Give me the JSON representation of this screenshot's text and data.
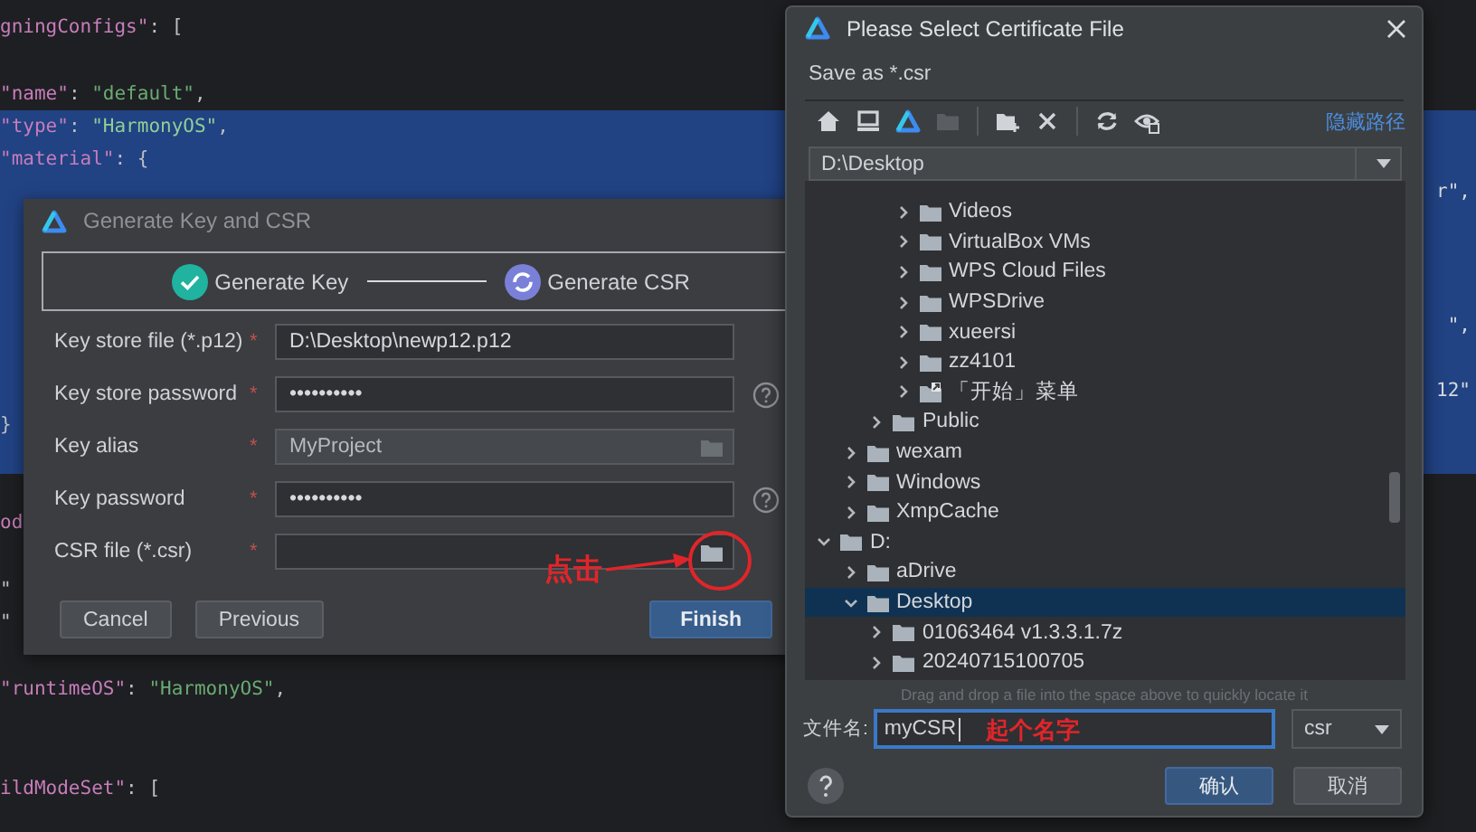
{
  "editor": {
    "lines": [
      {
        "tokens": [
          {
            "kind": "key",
            "text": "gningConfigs\""
          },
          {
            "kind": "punct",
            "text": ": ["
          }
        ],
        "selected": false
      },
      {
        "selected": false
      },
      {
        "tokens": [
          {
            "kind": "key",
            "text": "\"name\""
          },
          {
            "kind": "punct",
            "text": ": "
          },
          {
            "kind": "string",
            "text": "\"default\""
          },
          {
            "kind": "punct",
            "text": ","
          }
        ],
        "selected": false
      },
      {
        "tokens": [
          {
            "kind": "key",
            "text": "\"type\""
          },
          {
            "kind": "punct",
            "text": ": "
          },
          {
            "kind": "string",
            "text": "\"HarmonyOS\""
          },
          {
            "kind": "punct",
            "text": ","
          }
        ],
        "selected": true
      },
      {
        "tokens": [
          {
            "kind": "key",
            "text": "\"material\""
          },
          {
            "kind": "punct",
            "text": ": {"
          }
        ],
        "selected": true
      },
      {
        "tail": "r\",",
        "selected": true
      },
      {
        "selected": true
      },
      {
        "selected": true
      },
      {
        "selected": true
      },
      {
        "tail": "\",",
        "selected": true
      },
      {
        "selected": true
      },
      {
        "tail": "12\"",
        "selected": true
      },
      {
        "tokens": [
          {
            "kind": "punct",
            "text": "}"
          }
        ],
        "selected": true
      },
      {
        "selected": true
      },
      {
        "selected": false
      },
      {
        "tokens": [
          {
            "kind": "key",
            "text": "od"
          }
        ],
        "selected": false
      },
      {
        "selected": false
      },
      {
        "tokens": [
          {
            "kind": "punct",
            "text": "\""
          }
        ],
        "selected": false
      },
      {
        "tokens": [
          {
            "kind": "punct",
            "text": "\""
          }
        ],
        "selected": false
      },
      {
        "selected": false
      },
      {
        "tokens": [
          {
            "kind": "key",
            "text": "\"runtimeOS\""
          },
          {
            "kind": "punct",
            "text": ": "
          },
          {
            "kind": "string",
            "text": "\"HarmonyOS\""
          },
          {
            "kind": "punct",
            "text": ","
          }
        ],
        "selected": false
      },
      {
        "selected": false
      },
      {
        "selected": false
      },
      {
        "tokens": [
          {
            "kind": "key",
            "text": "ildModeSet\""
          },
          {
            "kind": "punct",
            "text": ": ["
          }
        ],
        "selected": false
      }
    ]
  },
  "key_dialog": {
    "title": "Generate Key and CSR",
    "steps": [
      {
        "label": "Generate Key",
        "done": true
      },
      {
        "label": "Generate CSR",
        "done": false
      }
    ],
    "fields": [
      {
        "label": "Key store file (*.p12)",
        "marker": "*",
        "value": "D:\\Desktop\\newp12.p12",
        "disabled": false,
        "browse": false,
        "help": false
      },
      {
        "label": "Key store password",
        "marker": "*",
        "value": "••••••••••",
        "disabled": false,
        "browse": false,
        "help": true
      },
      {
        "label": "Key alias",
        "marker": "*",
        "value": "MyProject",
        "disabled": true,
        "browse": true,
        "help": false
      },
      {
        "label": "Key password",
        "marker": "*",
        "value": "••••••••••",
        "disabled": false,
        "browse": false,
        "help": true
      },
      {
        "label": "CSR file (*.csr)",
        "marker": "*",
        "disabled": false,
        "browse": true,
        "help": false
      }
    ],
    "annotation": "点击",
    "buttons": [
      {
        "label": "Cancel",
        "primary": false
      },
      {
        "label": "Previous",
        "primary": false
      },
      {
        "label": "Finish",
        "primary": true
      }
    ]
  },
  "file_dialog": {
    "title": "Please Select Certificate File",
    "subtitle": "Save as *.csr",
    "toolbar": [
      [
        {
          "kind": "home",
          "disabled": false
        },
        {
          "kind": "computer",
          "disabled": false
        },
        {
          "kind": "logo",
          "disabled": false
        },
        {
          "kind": "folder",
          "disabled": true
        }
      ],
      [
        {
          "kind": "new-folder",
          "disabled": false
        },
        {
          "kind": "delete",
          "disabled": false
        }
      ],
      [
        {
          "kind": "refresh",
          "disabled": false
        },
        {
          "kind": "show-hidden",
          "disabled": false
        }
      ]
    ],
    "link": "隐藏路径",
    "path": "D:\\Desktop",
    "tree": [
      {
        "children": [
          {
            "children": [
              {
                "children": [
                  {
                    "label": "Videos",
                    "kind": "folder",
                    "expanded": false,
                    "selected": false
                  },
                  {
                    "label": "VirtualBox VMs",
                    "kind": "folder",
                    "expanded": false,
                    "selected": false
                  },
                  {
                    "label": "WPS Cloud Files",
                    "kind": "folder",
                    "expanded": false,
                    "selected": false
                  },
                  {
                    "label": "WPSDrive",
                    "kind": "folder",
                    "expanded": false,
                    "selected": false
                  },
                  {
                    "label": "xueersi",
                    "kind": "folder",
                    "expanded": false,
                    "selected": false
                  },
                  {
                    "label": "zz4101",
                    "kind": "folder",
                    "expanded": false,
                    "selected": false
                  },
                  {
                    "label": "「开始」菜单",
                    "kind": "shortcut",
                    "expanded": false,
                    "selected": false
                  }
                ]
              },
              {
                "label": "Public",
                "kind": "folder",
                "expanded": false,
                "selected": false
              }
            ]
          },
          {
            "label": "wexam",
            "kind": "folder",
            "expanded": false,
            "selected": false
          },
          {
            "label": "Windows",
            "kind": "folder",
            "expanded": false,
            "selected": false
          },
          {
            "label": "XmpCache",
            "kind": "folder",
            "expanded": false,
            "selected": false
          }
        ]
      },
      {
        "label": "D:",
        "kind": "folder",
        "expanded": true,
        "selected": false,
        "children": [
          {
            "label": "aDrive",
            "kind": "folder",
            "expanded": false,
            "selected": false
          },
          {
            "label": "Desktop",
            "kind": "folder",
            "expanded": true,
            "selected": true,
            "children": [
              {
                "label": "01063464 v1.3.3.1.7z",
                "kind": "folder",
                "expanded": false,
                "selected": false
              },
              {
                "label": "20240715100705",
                "kind": "folder",
                "expanded": false,
                "selected": false
              }
            ]
          }
        ]
      }
    ],
    "hint": "Drag and drop a file into the space above to quickly locate it",
    "filename_label": "文件名:",
    "filename": "myCSR",
    "annotation": "起个名字",
    "filetype": "csr",
    "buttons": [
      {
        "label": "确认",
        "primary": true
      },
      {
        "label": "取消",
        "primary": false
      }
    ]
  }
}
